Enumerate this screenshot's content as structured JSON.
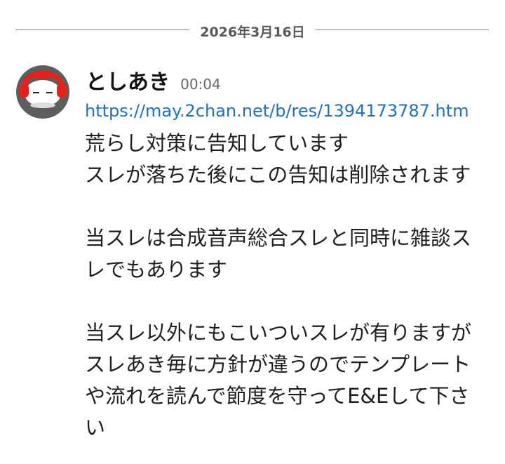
{
  "date_divider": {
    "text": "2026年3月16日"
  },
  "message": {
    "avatar_icon": "red-headphones-character-avatar-icon",
    "username": "としあき",
    "timestamp": "00:04",
    "link": "https://may.2chan.net/b/res/1394173787.htm",
    "body_lines": [
      "荒らし対策に告知しています",
      "スレが落ちた後にこの告知は削除されます",
      "",
      "当スレは合成音声総合スレと同時に雑談ス",
      "レでもあります",
      "",
      "当スレ以外にもこいついスレが有りますが",
      "スレあき毎に方針が違うのでテンプレート",
      "や流れを読んで節度を守ってE&Eして下さ",
      "い"
    ]
  },
  "colors": {
    "link": "#1a73c8",
    "avatar_bg": "#5e5e5e",
    "headphones": "#e8201a",
    "divider": "#8a8a8a"
  }
}
